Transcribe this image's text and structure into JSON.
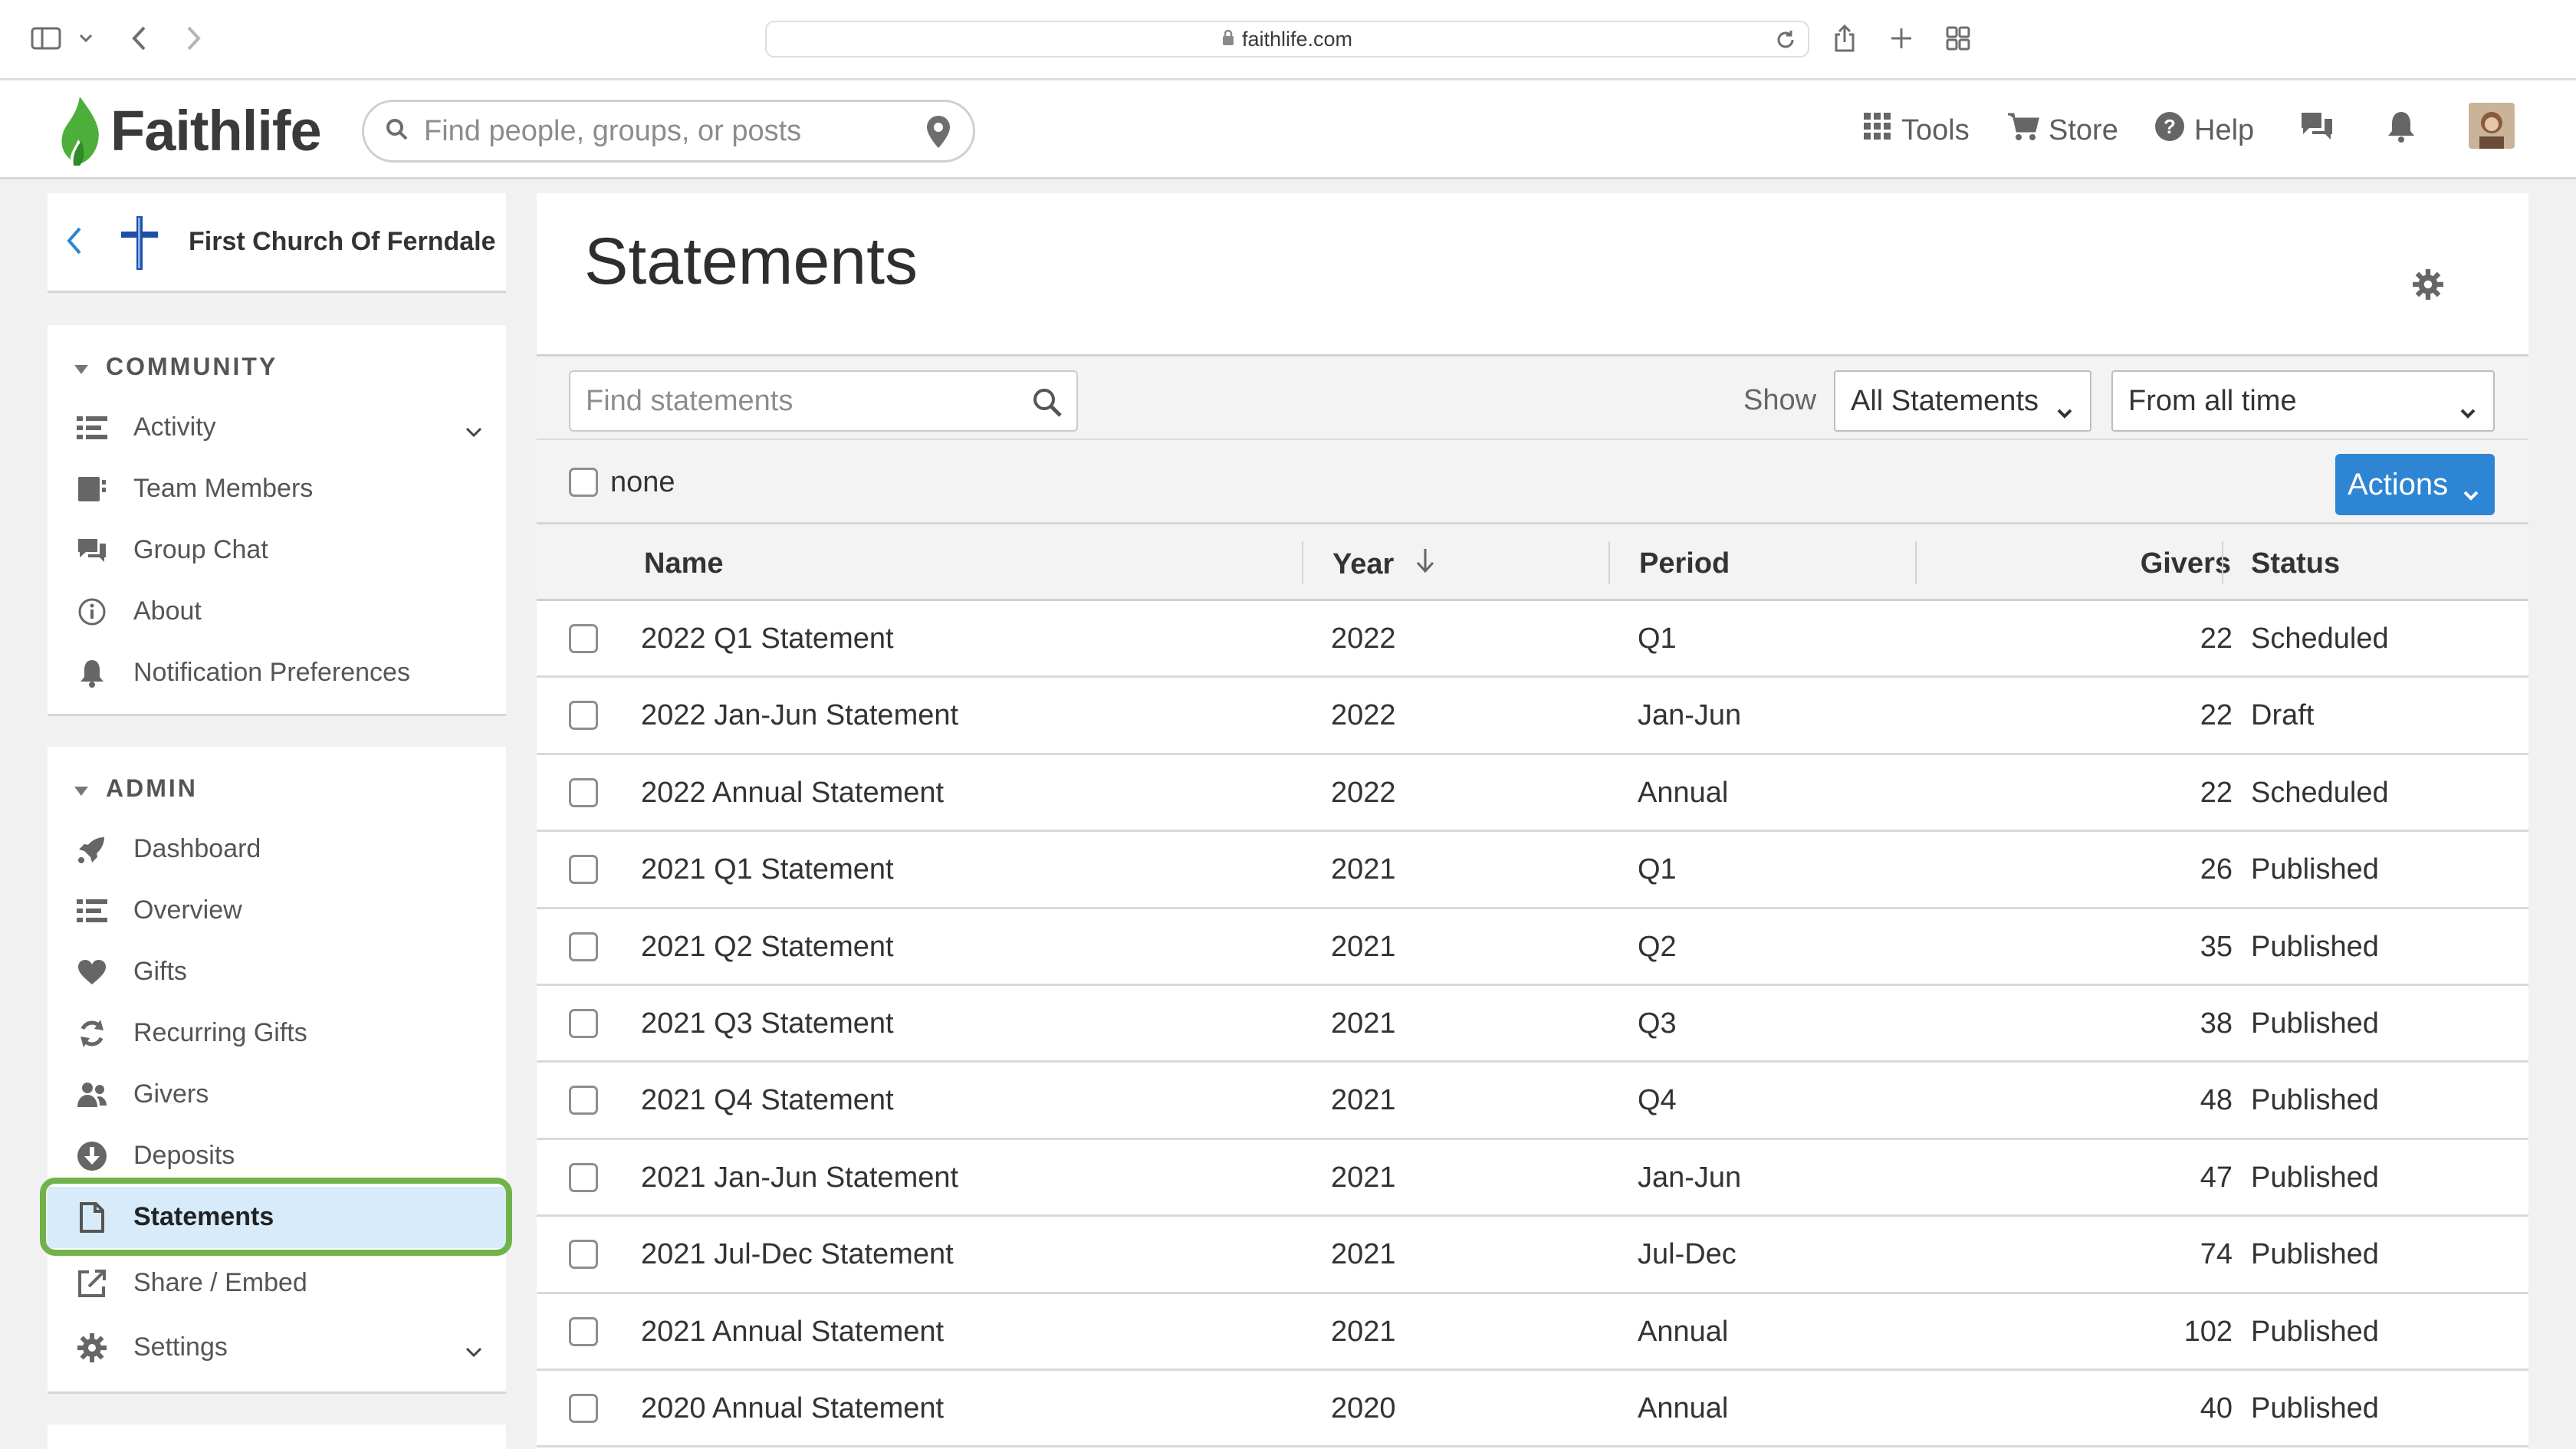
{
  "browser": {
    "url": "faithlife.com"
  },
  "header": {
    "logo_text": "Faithlife",
    "search_placeholder": "Find people, groups, or posts",
    "nav": {
      "tools": "Tools",
      "store": "Store",
      "help": "Help"
    }
  },
  "sidebar": {
    "church_name": "First Church Of Ferndale",
    "community": {
      "title": "COMMUNITY",
      "items": [
        {
          "label": "Activity",
          "icon": "activity-list-icon"
        },
        {
          "label": "Team Members",
          "icon": "team-members-icon"
        },
        {
          "label": "Group Chat",
          "icon": "chat-bubbles-icon"
        },
        {
          "label": "About",
          "icon": "info-icon"
        },
        {
          "label": "Notification Preferences",
          "icon": "bell-icon"
        }
      ]
    },
    "admin": {
      "title": "ADMIN",
      "items": [
        {
          "label": "Dashboard",
          "icon": "rocket-icon"
        },
        {
          "label": "Overview",
          "icon": "overview-list-icon"
        },
        {
          "label": "Gifts",
          "icon": "heart-icon"
        },
        {
          "label": "Recurring Gifts",
          "icon": "recurring-icon"
        },
        {
          "label": "Givers",
          "icon": "people-icon"
        },
        {
          "label": "Deposits",
          "icon": "download-circle-icon"
        },
        {
          "label": "Statements",
          "icon": "document-icon"
        },
        {
          "label": "Share / Embed",
          "icon": "external-link-icon"
        },
        {
          "label": "Settings",
          "icon": "gear-icon"
        }
      ]
    }
  },
  "main": {
    "title": "Statements",
    "find_placeholder": "Find statements",
    "show_label": "Show",
    "filter_type": "All Statements",
    "filter_time": "From all time",
    "select_none_label": "none",
    "actions_label": "Actions",
    "columns": {
      "name": "Name",
      "year": "Year",
      "period": "Period",
      "givers": "Givers",
      "status": "Status"
    },
    "rows": [
      {
        "name": "2022 Q1 Statement",
        "year": "2022",
        "period": "Q1",
        "givers": "22",
        "status": "Scheduled"
      },
      {
        "name": "2022 Jan-Jun Statement",
        "year": "2022",
        "period": "Jan-Jun",
        "givers": "22",
        "status": "Draft"
      },
      {
        "name": "2022 Annual Statement",
        "year": "2022",
        "period": "Annual",
        "givers": "22",
        "status": "Scheduled"
      },
      {
        "name": "2021 Q1 Statement",
        "year": "2021",
        "period": "Q1",
        "givers": "26",
        "status": "Published"
      },
      {
        "name": "2021 Q2 Statement",
        "year": "2021",
        "period": "Q2",
        "givers": "35",
        "status": "Published"
      },
      {
        "name": "2021 Q3 Statement",
        "year": "2021",
        "period": "Q3",
        "givers": "38",
        "status": "Published"
      },
      {
        "name": "2021 Q4 Statement",
        "year": "2021",
        "period": "Q4",
        "givers": "48",
        "status": "Published"
      },
      {
        "name": "2021 Jan-Jun Statement",
        "year": "2021",
        "period": "Jan-Jun",
        "givers": "47",
        "status": "Published"
      },
      {
        "name": "2021 Jul-Dec Statement",
        "year": "2021",
        "period": "Jul-Dec",
        "givers": "74",
        "status": "Published"
      },
      {
        "name": "2021 Annual Statement",
        "year": "2021",
        "period": "Annual",
        "givers": "102",
        "status": "Published"
      },
      {
        "name": "2020 Annual Statement",
        "year": "2020",
        "period": "Annual",
        "givers": "40",
        "status": "Published"
      }
    ]
  },
  "colors": {
    "accent": "#2e85d4",
    "active_nav_bg": "#d8ebfa",
    "highlight_ring": "#6fb34a",
    "logo_green": "#4caf3a"
  }
}
